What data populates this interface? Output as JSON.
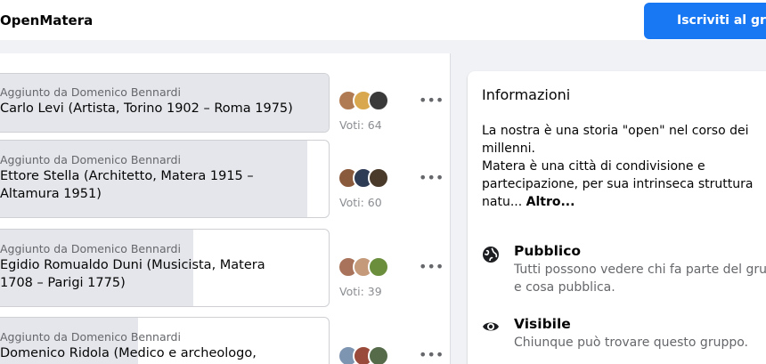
{
  "header": {
    "group_name": "OpenMatera",
    "join_label": "Iscriviti al gruppo",
    "join_color": "#1877f2"
  },
  "poll": {
    "options": [
      {
        "added_by": "Aggiunto da Domenico Bennardi",
        "lines": [
          "Carlo Levi (Artista, Torino 1902 – Roma 1975)"
        ],
        "votes_label": "Voti: 64",
        "votes": 64
      },
      {
        "added_by": "Aggiunto da Domenico Bennardi",
        "lines": [
          "Ettore Stella (Architetto, Matera 1915 –",
          "Altamura 1951)"
        ],
        "votes_label": "Voti: 60",
        "votes": 60
      },
      {
        "added_by": "Aggiunto da Domenico Bennardi",
        "lines": [
          "Egidio Romualdo Duni (Musicista, Matera",
          "1708 – Parigi 1775)"
        ],
        "votes_label": "Voti: 39",
        "votes": 39
      },
      {
        "added_by": "Aggiunto da Domenico Bennardi",
        "lines": [
          "Domenico Ridola (Medico e archeologo,"
        ],
        "votes_label": "",
        "votes": null
      }
    ],
    "more_icon": "ellipsis-icon"
  },
  "about": {
    "title": "Informazioni",
    "desc_lines": [
      "La nostra è una storia \"open\" nel corso dei",
      "millenni.",
      "Matera è una città di condivisione e",
      "partecipazione, per sua intrinseca struttura"
    ],
    "desc_last": "natu...",
    "more_link": "Altro...",
    "features": [
      {
        "icon": "globe-icon",
        "title": "Pubblico",
        "desc_lines": [
          "Tutti possono vedere chi fa parte del gruppo",
          "e cosa pubblica."
        ]
      },
      {
        "icon": "eye-icon",
        "title": "Visibile",
        "desc_lines": [
          "Chiunque può trovare questo gruppo."
        ]
      }
    ]
  }
}
